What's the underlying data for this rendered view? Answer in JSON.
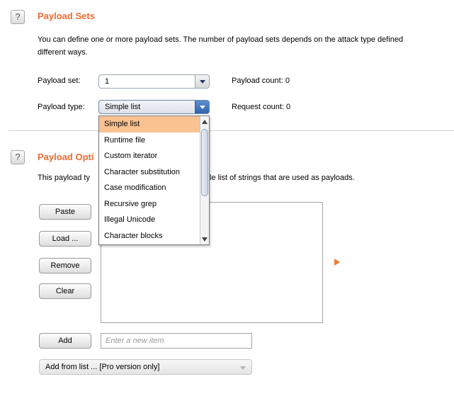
{
  "payload_sets": {
    "title": "Payload Sets",
    "description_line1": "You can define one or more payload sets. The number of payload sets depends on the attack type defined",
    "description_line2": "different ways.",
    "set_label": "Payload set:",
    "set_value": "1",
    "type_label": "Payload type:",
    "type_value": "Simple list",
    "payload_count": "Payload count: 0",
    "request_count": "Request count: 0"
  },
  "dropdown": {
    "options": [
      "Simple list",
      "Runtime file",
      "Custom iterator",
      "Character substitution",
      "Case modification",
      "Recursive grep",
      "Illegal Unicode",
      "Character blocks"
    ],
    "selected_index": 0
  },
  "payload_options": {
    "title": "Payload Opti",
    "description_left": "This payload ty",
    "description_right": "le list of strings that are used as payloads.",
    "buttons": {
      "paste": "Paste",
      "load": "Load ...",
      "remove": "Remove",
      "clear": "Clear",
      "add": "Add"
    },
    "new_item_placeholder": "Enter a new item",
    "add_from_list": "Add from list ... [Pro version only]"
  },
  "icons": {
    "help": "?",
    "play": "play-icon"
  },
  "colors": {
    "accent": "#ef6c2f",
    "selected_item": "#fbc291"
  }
}
